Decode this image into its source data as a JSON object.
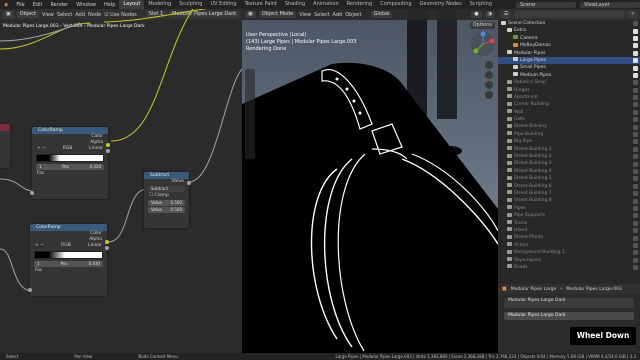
{
  "menu": [
    "File",
    "Edit",
    "Render",
    "Window",
    "Help"
  ],
  "workspaces": [
    "Layout",
    "Modeling",
    "Sculpting",
    "UV Editing",
    "Texture Paint",
    "Shading",
    "Animation",
    "Rendering",
    "Compositing",
    "Geometry Nodes",
    "Scripting"
  ],
  "active_workspace": "Layout",
  "scene": "Scene",
  "view_layer": "ViewLayer",
  "node_editor": {
    "header": {
      "mode": "Object",
      "view": "View",
      "select": "Select",
      "add": "Add",
      "node": "Node",
      "use_nodes": "Use Nodes",
      "slot": "Slot 1",
      "material": "Modular Pipes Large Dark"
    },
    "breadcrumb": [
      "Modular Pipes Large.003",
      "Vert.004",
      "Modular Pipes Large Dark"
    ],
    "colorramp_1": {
      "title": "ColorRamp",
      "out_color": "Color",
      "out_alpha": "Alpha",
      "mode": "RGB",
      "interp": "Linear",
      "pos_label": "Pos",
      "pos_index": "1",
      "pos_value": "0.330",
      "fac": "Fac"
    },
    "colorramp_2": {
      "title": "ColorRamp",
      "out_color": "Color",
      "out_alpha": "Alpha",
      "mode": "RGB",
      "interp": "Linear",
      "pos_label": "Pos",
      "pos_index": "1",
      "pos_value": "0.430",
      "fac": "Fac"
    },
    "subtract": {
      "title": "Subtract",
      "out": "Value",
      "op": "Subtract",
      "clamp": "Clamp",
      "v1_label": "Value",
      "v1": "0.500",
      "v2_label": "Value",
      "v2": "0.500"
    }
  },
  "viewport": {
    "header": {
      "mode": "Object Mode",
      "view": "View",
      "select": "Select",
      "add": "Add",
      "object": "Object",
      "orientation": "Global",
      "options": "Options"
    },
    "overlay": [
      "User Perspective (Local)",
      "(143) Large Pipes | Modular Pipes Large.003",
      "Rendering Done"
    ]
  },
  "outliner": {
    "search_placeholder": "",
    "items": [
      {
        "label": "Scene Collection",
        "indent": 0,
        "icon": "white",
        "check": false,
        "dim": false,
        "sel": false
      },
      {
        "label": "Extra",
        "indent": 1,
        "icon": "white",
        "check": true,
        "dim": false,
        "sel": false
      },
      {
        "label": "Camera",
        "indent": 2,
        "icon": "green",
        "check": true,
        "dim": false,
        "sel": false
      },
      {
        "label": "MyBoyDemos",
        "indent": 2,
        "icon": "orange",
        "check": true,
        "dim": false,
        "sel": false
      },
      {
        "label": "Modular Pipes",
        "indent": 1,
        "icon": "white",
        "check": true,
        "dim": false,
        "sel": false
      },
      {
        "label": "Large Pipes",
        "indent": 2,
        "icon": "white",
        "check": true,
        "dim": false,
        "sel": true
      },
      {
        "label": "Small Pipes",
        "indent": 2,
        "icon": "white",
        "check": true,
        "dim": false,
        "sel": false
      },
      {
        "label": "Medium Pipes",
        "indent": 2,
        "icon": "white",
        "check": true,
        "dim": false,
        "sel": false
      },
      {
        "label": "Robotics Shop",
        "indent": 1,
        "icon": "grey",
        "check": false,
        "dim": true,
        "sel": false
      },
      {
        "label": "Hinges",
        "indent": 1,
        "icon": "grey",
        "check": false,
        "dim": true,
        "sel": false
      },
      {
        "label": "Apartment",
        "indent": 1,
        "icon": "grey",
        "check": false,
        "dim": true,
        "sel": false
      },
      {
        "label": "Corner Building",
        "indent": 1,
        "icon": "grey",
        "check": false,
        "dim": true,
        "sel": false
      },
      {
        "label": "Wall",
        "indent": 1,
        "icon": "grey",
        "check": false,
        "dim": true,
        "sel": false
      },
      {
        "label": "Gate",
        "indent": 1,
        "icon": "grey",
        "check": false,
        "dim": true,
        "sel": false
      },
      {
        "label": "Street Balcony",
        "indent": 1,
        "icon": "grey",
        "check": false,
        "dim": true,
        "sel": false
      },
      {
        "label": "Pipe Building",
        "indent": 1,
        "icon": "grey",
        "check": false,
        "dim": true,
        "sel": false
      },
      {
        "label": "Big Pipe",
        "indent": 1,
        "icon": "grey",
        "check": false,
        "dim": true,
        "sel": false
      },
      {
        "label": "Street Building 1",
        "indent": 1,
        "icon": "grey",
        "check": false,
        "dim": true,
        "sel": false
      },
      {
        "label": "Street Building 2",
        "indent": 1,
        "icon": "grey",
        "check": false,
        "dim": true,
        "sel": false
      },
      {
        "label": "Street Building 3",
        "indent": 1,
        "icon": "grey",
        "check": false,
        "dim": true,
        "sel": false
      },
      {
        "label": "Street Building 4",
        "indent": 1,
        "icon": "grey",
        "check": false,
        "dim": true,
        "sel": false
      },
      {
        "label": "Street Building 5",
        "indent": 1,
        "icon": "grey",
        "check": false,
        "dim": true,
        "sel": false
      },
      {
        "label": "Street Building 6",
        "indent": 1,
        "icon": "grey",
        "check": false,
        "dim": true,
        "sel": false
      },
      {
        "label": "Street Building 7",
        "indent": 1,
        "icon": "grey",
        "check": false,
        "dim": true,
        "sel": false
      },
      {
        "label": "Street Building 8",
        "indent": 1,
        "icon": "grey",
        "check": false,
        "dim": true,
        "sel": false
      },
      {
        "label": "Pipes",
        "indent": 1,
        "icon": "grey",
        "check": false,
        "dim": true,
        "sel": false
      },
      {
        "label": "Pipe Supports",
        "indent": 1,
        "icon": "grey",
        "check": false,
        "dim": true,
        "sel": false
      },
      {
        "label": "Trains",
        "indent": 1,
        "icon": "grey",
        "check": false,
        "dim": true,
        "sel": false
      },
      {
        "label": "Island",
        "indent": 1,
        "icon": "grey",
        "check": false,
        "dim": true,
        "sel": false
      },
      {
        "label": "Street Plants",
        "indent": 1,
        "icon": "grey",
        "check": false,
        "dim": true,
        "sel": false
      },
      {
        "label": "Actors",
        "indent": 1,
        "icon": "grey",
        "check": false,
        "dim": true,
        "sel": false
      },
      {
        "label": "Background Building 1",
        "indent": 1,
        "icon": "grey",
        "check": false,
        "dim": true,
        "sel": false
      },
      {
        "label": "Skyscrapers",
        "indent": 1,
        "icon": "grey",
        "check": false,
        "dim": true,
        "sel": false
      },
      {
        "label": "Roads",
        "indent": 1,
        "icon": "grey",
        "check": false,
        "dim": true,
        "sel": false
      }
    ]
  },
  "properties": {
    "object": "Modular Pipes Large",
    "material": "Modular Pipes Large.003",
    "slot_material": "Modular Pipes Large Dark",
    "data_material": "Modular Pipes Large Dark"
  },
  "statusbar": {
    "select": "Select",
    "pan": "Pan View",
    "context": "Node Context Menu",
    "stats": "Large Pipes | Modular Pipes Large.003 | Verts 1,383,880 | Faces 1,368,288 | Tris 2,768,233 | Objects 0/44 | Memory 5.68 GiB | VRAM 4.2/24.0 GiB | 3.3"
  },
  "overlay_badge": "Wheel Down"
}
